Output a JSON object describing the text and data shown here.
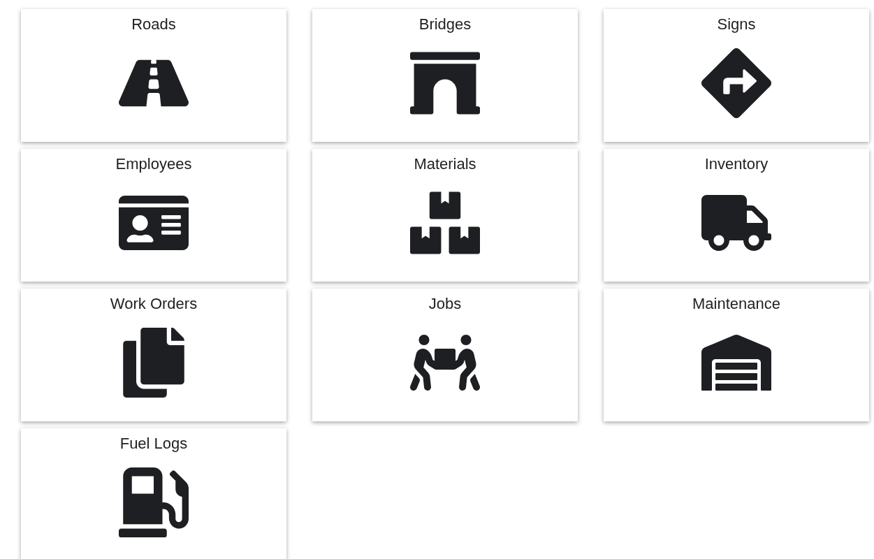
{
  "tiles": [
    {
      "label": "Roads"
    },
    {
      "label": "Bridges"
    },
    {
      "label": "Signs"
    },
    {
      "label": "Employees"
    },
    {
      "label": "Materials"
    },
    {
      "label": "Inventory"
    },
    {
      "label": "Work Orders"
    },
    {
      "label": "Jobs"
    },
    {
      "label": "Maintenance"
    },
    {
      "label": "Fuel Logs"
    }
  ]
}
